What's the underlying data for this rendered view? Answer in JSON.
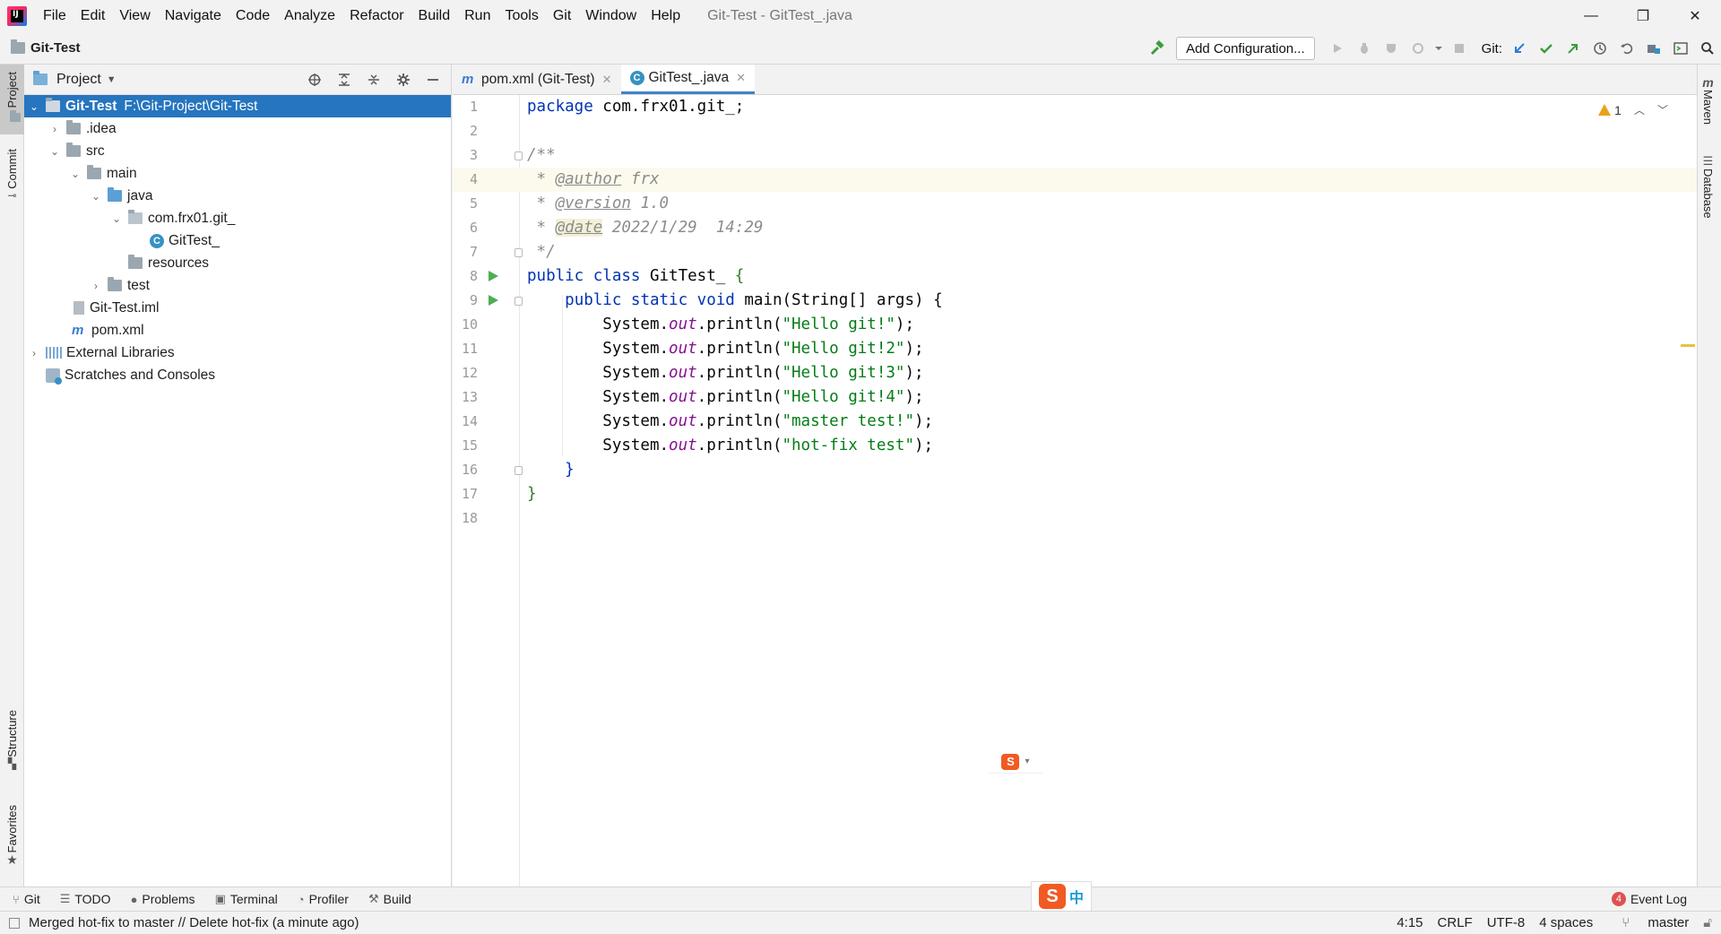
{
  "menubar": {
    "logo_text": "IJ",
    "items": [
      "File",
      "Edit",
      "View",
      "Navigate",
      "Code",
      "Analyze",
      "Refactor",
      "Build",
      "Run",
      "Tools",
      "Git",
      "Window",
      "Help"
    ],
    "window_title": "Git-Test - GitTest_.java",
    "window_controls": [
      "—",
      "❐",
      "✕"
    ]
  },
  "navbar": {
    "project_name": "Git-Test",
    "add_configuration": "Add Configuration...",
    "git_label": "Git:"
  },
  "left_strip": {
    "project": "Project",
    "commit": "Commit",
    "structure": "Structure",
    "favorites": "Favorites"
  },
  "right_strip": {
    "maven": "Maven",
    "database": "Database"
  },
  "project_panel": {
    "title": "Project",
    "tree": [
      {
        "label": "Git-Test",
        "path": "F:\\Git-Project\\Git-Test"
      },
      {
        "label": ".idea"
      },
      {
        "label": "src"
      },
      {
        "label": "main"
      },
      {
        "label": "java"
      },
      {
        "label": "com.frx01.git_"
      },
      {
        "label": "GitTest_"
      },
      {
        "label": "resources"
      },
      {
        "label": "test"
      },
      {
        "label": "Git-Test.iml"
      },
      {
        "label": "pom.xml"
      },
      {
        "label": "External Libraries"
      },
      {
        "label": "Scratches and Consoles"
      }
    ]
  },
  "editor": {
    "tabs": [
      {
        "label": "pom.xml (Git-Test)",
        "icon": "maven-icon"
      },
      {
        "label": "GitTest_.java",
        "icon": "class-icon"
      }
    ],
    "warning_count": "1",
    "line_numbers": [
      "1",
      "2",
      "3",
      "4",
      "5",
      "6",
      "7",
      "8",
      "9",
      "10",
      "11",
      "12",
      "13",
      "14",
      "15",
      "16",
      "17",
      "18"
    ],
    "code": {
      "l1_kw": "package",
      "l1_rest": " com.frx01.git_;",
      "l3": "/**",
      "l4_pre": " * ",
      "l4_tag": "@author",
      "l4_val": " frx",
      "l5_pre": " * ",
      "l5_tag": "@version",
      "l5_val": " 1.0",
      "l6_pre": " * ",
      "l6_tag": "@date",
      "l6_val": " 2022/1/29  14:29",
      "l7": " */",
      "l8_kw": "public class",
      "l8_name": " GitTest_ ",
      "l8_brace": "{",
      "l9_indent": "    ",
      "l9_kw": "public static void",
      "l9_rest": " main(String[] args) {",
      "println_lines": [
        {
          "pre": "        System.",
          "fld": "out",
          "mid": ".println(",
          "str": "\"Hello git!\"",
          "end": ");"
        },
        {
          "pre": "        System.",
          "fld": "out",
          "mid": ".println(",
          "str": "\"Hello git!2\"",
          "end": ");"
        },
        {
          "pre": "        System.",
          "fld": "out",
          "mid": ".println(",
          "str": "\"Hello git!3\"",
          "end": ");"
        },
        {
          "pre": "        System.",
          "fld": "out",
          "mid": ".println(",
          "str": "\"Hello git!4\"",
          "end": ");"
        },
        {
          "pre": "        System.",
          "fld": "out",
          "mid": ".println(",
          "str": "\"master test!\"",
          "end": ");"
        },
        {
          "pre": "        System.",
          "fld": "out",
          "mid": ".println(",
          "str": "\"hot-fix test\"",
          "end": ");"
        }
      ],
      "l16": "    }",
      "l17": "}"
    }
  },
  "bottom_bar": {
    "tools": [
      "Git",
      "TODO",
      "Problems",
      "Terminal",
      "Profiler",
      "Build"
    ],
    "event_log": "Event Log",
    "event_count": "4",
    "ime_s": "S",
    "ime_zh": "中"
  },
  "status_bar": {
    "message": "Merged hot-fix to master // Delete hot-fix (a minute ago)",
    "position": "4:15",
    "line_sep": "CRLF",
    "encoding": "UTF-8",
    "indent": "4 spaces",
    "branch": "master"
  },
  "colors": {
    "accent": "#2675bf",
    "keyword": "#0033b3",
    "string": "#067d17",
    "comment": "#8c8c8c",
    "field": "#871094"
  }
}
